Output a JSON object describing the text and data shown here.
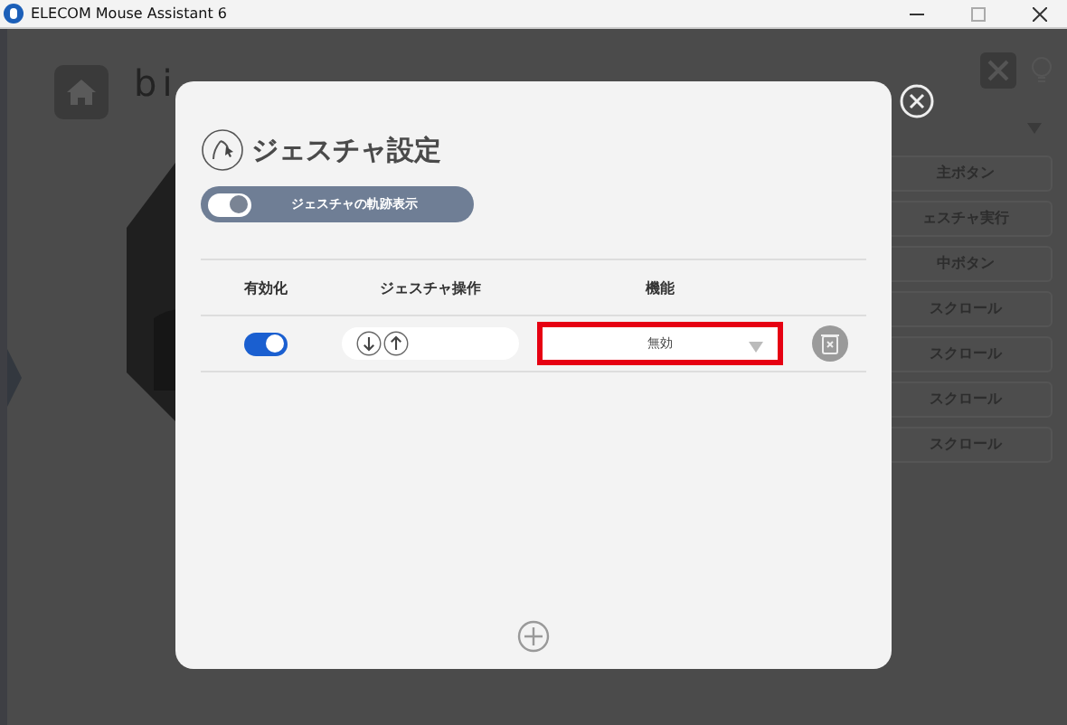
{
  "window": {
    "title": "ELECOM Mouse Assistant 6"
  },
  "background": {
    "logo": "bi",
    "button_list": [
      "主ボタン",
      "ェスチャ実行",
      "中ボタン",
      "スクロール",
      "スクロール",
      "スクロール",
      "スクロール"
    ]
  },
  "dialog": {
    "title": "ジェスチャ設定",
    "trail_toggle": {
      "label": "ジェスチャの軌跡表示",
      "on": true
    },
    "columns": [
      "有効化",
      "ジェスチャ操作",
      "機能"
    ],
    "rows": [
      {
        "enabled": true,
        "strokes": [
          {
            "kind": "down"
          },
          {
            "kind": "up"
          }
        ],
        "function": "無効",
        "highlighted": true
      }
    ]
  }
}
